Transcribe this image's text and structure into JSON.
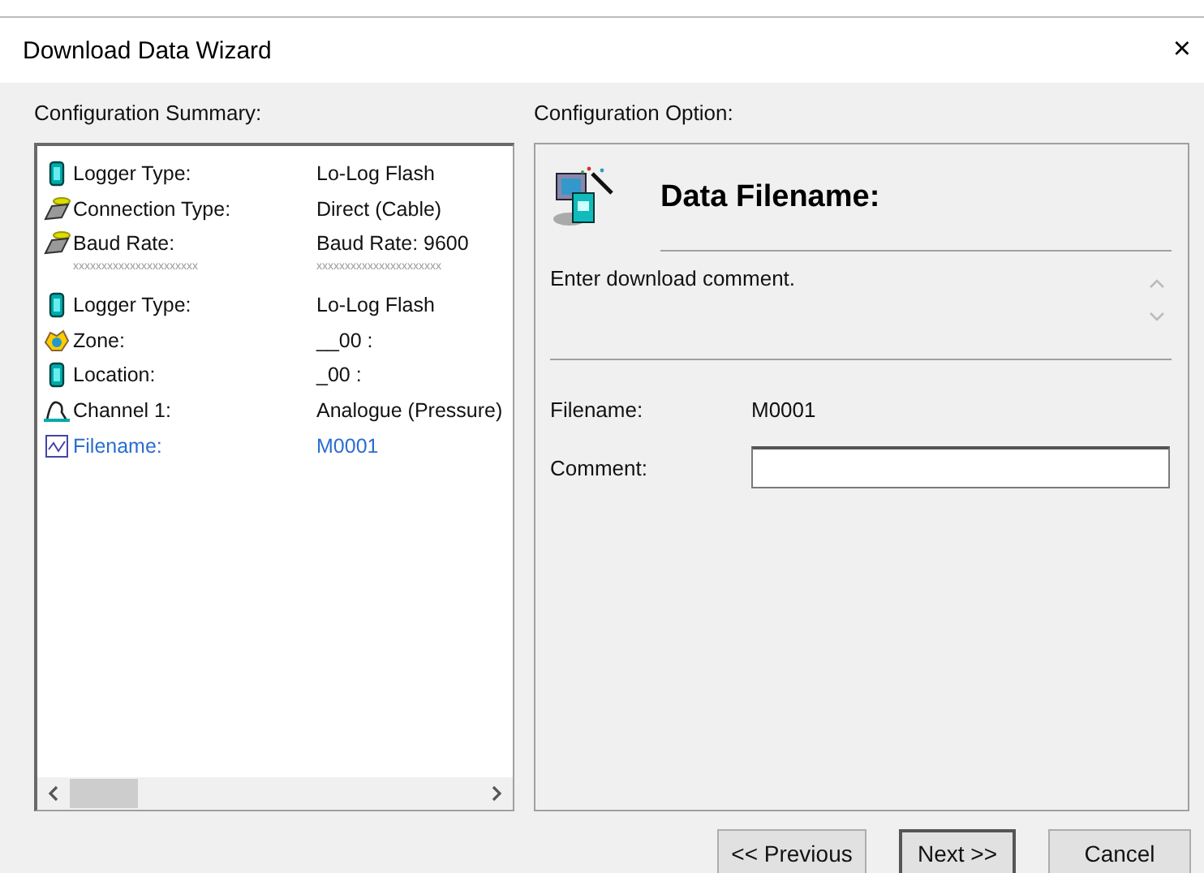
{
  "window": {
    "title": "Download Data Wizard",
    "close": "×"
  },
  "summary": {
    "heading": "Configuration Summary:",
    "rows": [
      {
        "kind": "logger",
        "label": "Logger Type:",
        "value": "Lo-Log Flash",
        "selected": false
      },
      {
        "kind": "cable",
        "label": "Connection Type:",
        "value": "Direct (Cable)",
        "selected": false
      },
      {
        "kind": "cable",
        "label": "Baud Rate:",
        "value": "Baud Rate: 9600",
        "selected": false
      },
      {
        "kind": "separator",
        "label": "xxxxxxxxxxxxxxxxxxxxxx",
        "value": "xxxxxxxxxxxxxxxxxxxxxx",
        "selected": false
      },
      {
        "kind": "logger",
        "label": "Logger Type:",
        "value": "Lo-Log Flash",
        "selected": false
      },
      {
        "kind": "zone",
        "label": "Zone:",
        "value": "__00 :",
        "selected": false
      },
      {
        "kind": "logger",
        "label": "Location:",
        "value": "_00 :",
        "selected": false
      },
      {
        "kind": "channel",
        "label": "Channel 1:",
        "value": "Analogue (Pressure)",
        "selected": false
      },
      {
        "kind": "file",
        "label": "Filename:",
        "value": "M0001",
        "selected": true
      }
    ]
  },
  "option": {
    "heading": "Configuration Option:",
    "title": "Data Filename:",
    "description": "Enter download comment.",
    "fields": [
      {
        "kind": "text",
        "label": "Filename:",
        "value": "M0001"
      },
      {
        "kind": "input",
        "label": "Comment:"
      }
    ]
  },
  "buttons": [
    {
      "label": "<< Previous",
      "default": false
    },
    {
      "label": "Next >>",
      "default": true
    },
    {
      "label": "Cancel",
      "default": false
    }
  ]
}
